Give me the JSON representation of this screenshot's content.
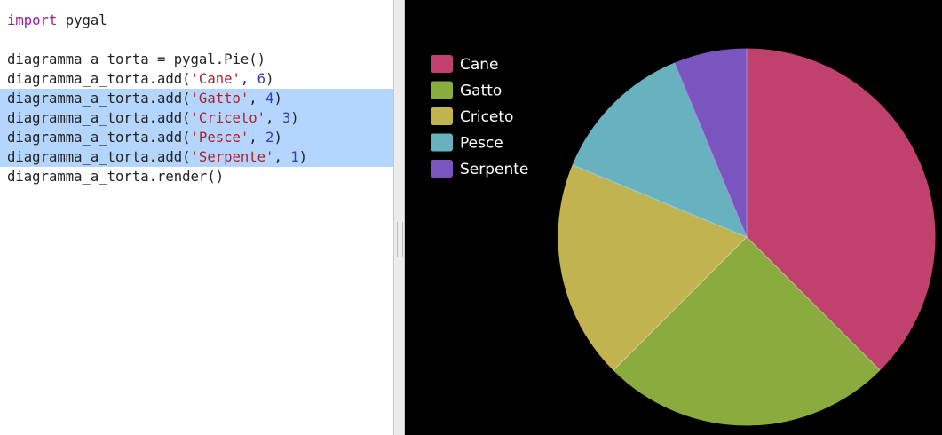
{
  "editor": {
    "lines": [
      {
        "selected": false,
        "tokens": [
          {
            "t": "kw",
            "v": "import"
          },
          {
            "t": "plain",
            "v": " pygal"
          }
        ]
      },
      {
        "selected": false,
        "tokens": []
      },
      {
        "selected": false,
        "tokens": [
          {
            "t": "plain",
            "v": "diagramma_a_torta = pygal.Pie()"
          }
        ]
      },
      {
        "selected": false,
        "tokens": [
          {
            "t": "plain",
            "v": "diagramma_a_torta.add("
          },
          {
            "t": "str",
            "v": "'Cane'"
          },
          {
            "t": "plain",
            "v": ", "
          },
          {
            "t": "num",
            "v": "6"
          },
          {
            "t": "plain",
            "v": ")"
          }
        ]
      },
      {
        "selected": true,
        "tokens": [
          {
            "t": "plain",
            "v": "diagramma_a_torta.add("
          },
          {
            "t": "str",
            "v": "'Gatto'"
          },
          {
            "t": "plain",
            "v": ", "
          },
          {
            "t": "num",
            "v": "4"
          },
          {
            "t": "plain",
            "v": ")"
          }
        ]
      },
      {
        "selected": true,
        "tokens": [
          {
            "t": "plain",
            "v": "diagramma_a_torta.add("
          },
          {
            "t": "str",
            "v": "'Criceto'"
          },
          {
            "t": "plain",
            "v": ", "
          },
          {
            "t": "num",
            "v": "3"
          },
          {
            "t": "plain",
            "v": ")"
          }
        ]
      },
      {
        "selected": true,
        "tokens": [
          {
            "t": "plain",
            "v": "diagramma_a_torta.add("
          },
          {
            "t": "str",
            "v": "'Pesce'"
          },
          {
            "t": "plain",
            "v": ", "
          },
          {
            "t": "num",
            "v": "2"
          },
          {
            "t": "plain",
            "v": ")"
          }
        ]
      },
      {
        "selected": true,
        "tokens": [
          {
            "t": "plain",
            "v": "diagramma_a_torta.add("
          },
          {
            "t": "str",
            "v": "'Serpente'"
          },
          {
            "t": "plain",
            "v": ", "
          },
          {
            "t": "num",
            "v": "1"
          },
          {
            "t": "plain",
            "v": ")"
          }
        ]
      },
      {
        "selected": false,
        "tokens": [
          {
            "t": "plain",
            "v": "diagramma_a_torta.render()"
          }
        ]
      }
    ]
  },
  "chart_data": {
    "type": "pie",
    "categories": [
      "Cane",
      "Gatto",
      "Criceto",
      "Pesce",
      "Serpente"
    ],
    "values": [
      6,
      4,
      3,
      2,
      1
    ],
    "colors": [
      "#c0406e",
      "#8aab3e",
      "#c1b350",
      "#68b2c0",
      "#7a55c0"
    ],
    "title": "",
    "legend_position": "top-left",
    "background": "#000000"
  }
}
